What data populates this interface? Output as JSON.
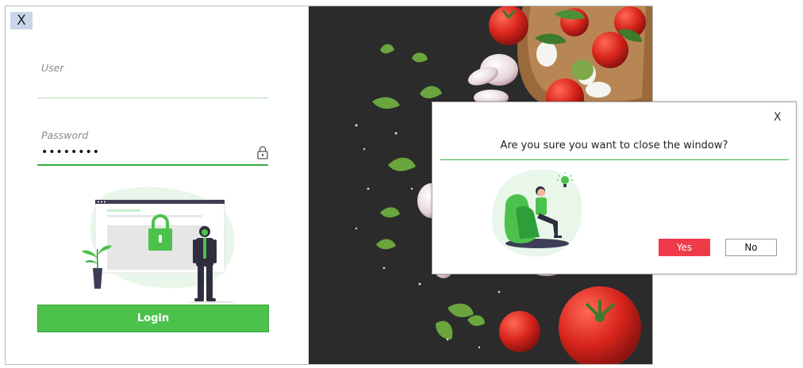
{
  "login_window": {
    "close_label": "X",
    "user_field": {
      "label": "User",
      "value": ""
    },
    "password_field": {
      "label": "Password",
      "value": "••••••••"
    },
    "login_label": "Login",
    "colors": {
      "accent": "#4cc24c",
      "close_bg": "#c9d6e8"
    }
  },
  "dialog": {
    "close_label": "X",
    "message": "Are you sure you want to close the window?",
    "yes_label": "Yes",
    "no_label": "No",
    "colors": {
      "yes_bg": "#ef3a4a",
      "divider": "#3aae3f"
    }
  }
}
